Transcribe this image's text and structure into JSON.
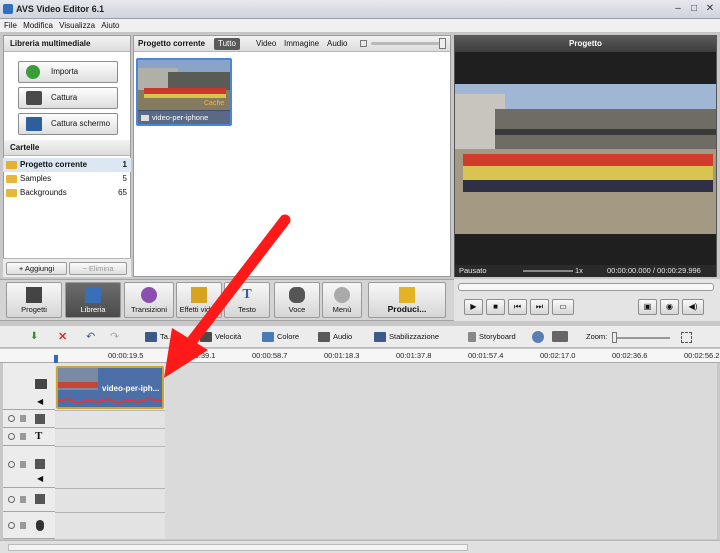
{
  "window": {
    "title": "AVS Video Editor 6.1"
  },
  "menu": [
    "File",
    "Modifica",
    "Visualizza",
    "Aiuto"
  ],
  "library": {
    "header": "Libreria multimediale",
    "buttons": [
      "Importa",
      "Cattura",
      "Cattura schermo"
    ],
    "folders_header": "Cartelle",
    "folders": [
      {
        "name": "Progetto corrente",
        "count": "1"
      },
      {
        "name": "Samples",
        "count": "5"
      },
      {
        "name": "Backgrounds",
        "count": "65"
      }
    ],
    "add_label": "+ Aggiungi",
    "delete_label": "− Elimina"
  },
  "media": {
    "header": "Progetto corrente",
    "tabs": [
      "Tutto",
      "Video",
      "Immagine",
      "Audio"
    ],
    "selected_tab": "Tutto",
    "item_name": "video-per-iphone",
    "item_badge": "Cache"
  },
  "preview": {
    "title": "Progetto",
    "status": "Pausato",
    "speed": "1x",
    "time": "00:00:00.000 / 00:00:29.996"
  },
  "toolbar": [
    "Progetti",
    "Libreria",
    "Transizioni",
    "Effetti video",
    "Testo",
    "Voce",
    "Menù",
    "Produci..."
  ],
  "timeline_tools": {
    "labels": [
      "Ta...",
      "Velocità",
      "Colore",
      "Audio",
      "Stabilizzazione",
      "Storyboard",
      "Zoom:"
    ]
  },
  "ruler": [
    "00:00:19.5",
    "00:00:39.1",
    "00:00:58.7",
    "00:01:18.3",
    "00:01:37.8",
    "00:01:57.4",
    "00:02:17.0",
    "00:02:36.6",
    "00:02:56.2"
  ],
  "clip": {
    "label": "video-per-iph..."
  }
}
